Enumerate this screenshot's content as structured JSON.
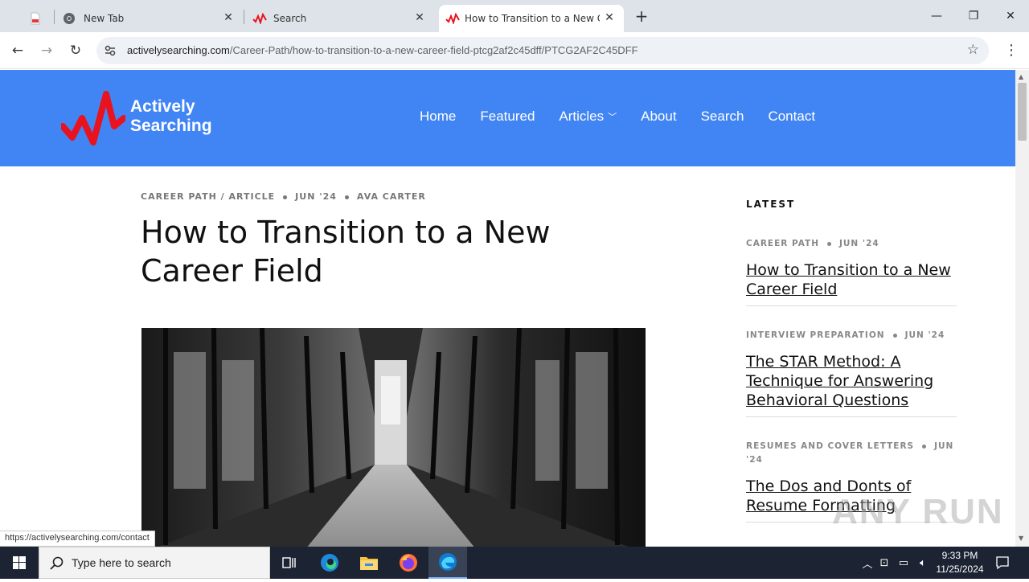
{
  "browser": {
    "tabs": [
      {
        "title": "",
        "icon": "pdf-icon"
      },
      {
        "title": "New Tab",
        "icon": "chrome-icon"
      },
      {
        "title": "Search",
        "icon": "site-logo-icon"
      },
      {
        "title": "How to Transition to a New Car",
        "icon": "site-logo-icon"
      }
    ],
    "url_domain": "activelysearching.com",
    "url_path": "/Career-Path/how-to-transition-to-a-new-career-field-ptcg2af2c45dff/PTCG2AF2C45DFF",
    "status_url": "https://activelysearching.com/contact"
  },
  "site": {
    "logo_line1": "Actively",
    "logo_line2": "Searching",
    "nav": [
      "Home",
      "Featured",
      "Articles",
      "About",
      "Search",
      "Contact"
    ],
    "accent_color": "#4185f4",
    "logo_color": "#e8131e"
  },
  "article": {
    "category": "CAREER PATH / ARTICLE",
    "date": "JUN '24",
    "author": "AVA CARTER",
    "title": "How to Transition to a New Career Field"
  },
  "sidebar": {
    "heading": "LATEST",
    "items": [
      {
        "category": "CAREER PATH",
        "date": "JUN '24",
        "title": "How to Transition to a New Career Field"
      },
      {
        "category": "INTERVIEW PREPARATION",
        "date": "JUN '24",
        "title": "The STAR Method: A Technique for Answering Behavioral Questions"
      },
      {
        "category": "RESUMES AND COVER LETTERS",
        "date": "JUN '24",
        "title": "The Dos and Donts of Resume Formatting"
      }
    ]
  },
  "taskbar": {
    "search_placeholder": "Type here to search",
    "time": "9:33 PM",
    "date": "11/25/2024"
  },
  "watermark": "ANY RUN"
}
